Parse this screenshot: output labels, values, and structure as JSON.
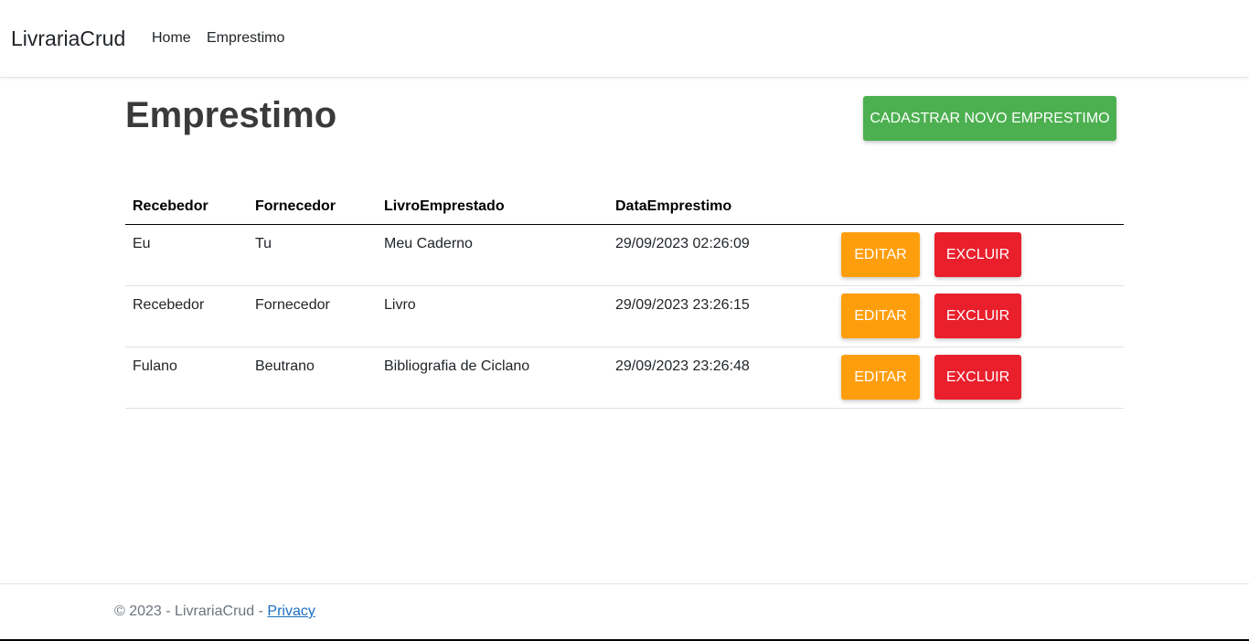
{
  "navbar": {
    "brand": "LivrariaCrud",
    "links": [
      {
        "label": "Home"
      },
      {
        "label": "Emprestimo"
      }
    ]
  },
  "page": {
    "title": "Emprestimo",
    "new_button_label": "CADASTRAR NOVO EMPRESTIMO"
  },
  "table": {
    "columns": [
      "Recebedor",
      "Fornecedor",
      "LivroEmprestado",
      "DataEmprestimo"
    ],
    "rows": [
      {
        "recebedor": "Eu",
        "fornecedor": "Tu",
        "livro": "Meu Caderno",
        "data": "29/09/2023 02:26:09"
      },
      {
        "recebedor": "Recebedor",
        "fornecedor": "Fornecedor",
        "livro": "Livro",
        "data": "29/09/2023 23:26:15"
      },
      {
        "recebedor": "Fulano",
        "fornecedor": "Beutrano",
        "livro": "Bibliografia de Ciclano",
        "data": "29/09/2023 23:26:48"
      }
    ],
    "edit_label": "EDITAR",
    "delete_label": "EXCLUIR"
  },
  "footer": {
    "copyright": "© 2023 - LivrariaCrud - ",
    "privacy_label": "Privacy"
  },
  "colors": {
    "primary_action": "#4cb050",
    "edit": "#ff9e0d",
    "delete": "#e91f2c",
    "link": "#1b6ec2"
  }
}
